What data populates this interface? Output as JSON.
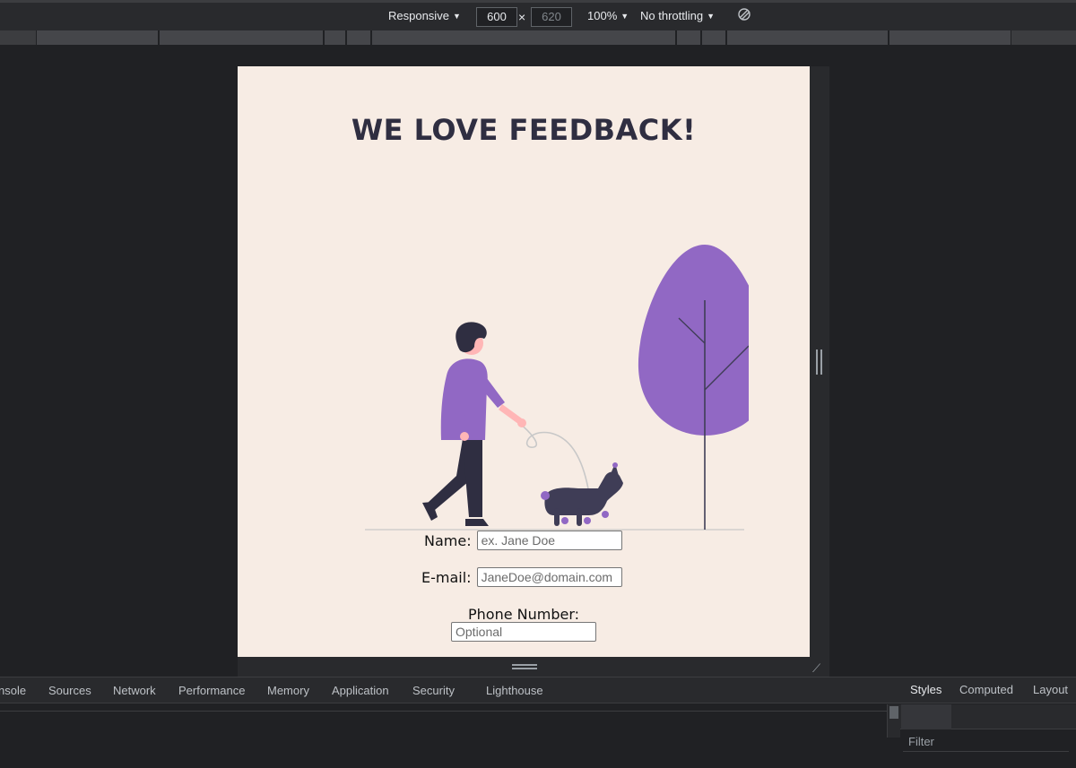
{
  "device_toolbar": {
    "device_label": "Responsive",
    "width_value": "600",
    "height_value": "620",
    "times": "×",
    "zoom": "100%",
    "throttling": "No throttling",
    "rotate_icon": "rotate-icon"
  },
  "page": {
    "title": "WE LOVE FEEDBACK!",
    "form": {
      "name_label": "Name:",
      "name_placeholder": "ex. Jane Doe",
      "email_label": "E-mail:",
      "email_placeholder": "JaneDoe@domain.com",
      "phone_label": "Phone Number:",
      "phone_placeholder": "Optional"
    },
    "colors": {
      "background": "#f7ece4",
      "accent": "#9168c4",
      "title": "#2f2e41"
    }
  },
  "devtools": {
    "tabs": [
      "nsole",
      "Sources",
      "Network",
      "Performance",
      "Memory",
      "Application",
      "Security",
      "Lighthouse"
    ],
    "side_tabs": [
      "Styles",
      "Computed",
      "Layout"
    ],
    "active_side_tab": "Styles",
    "filter_placeholder": "Filter"
  }
}
